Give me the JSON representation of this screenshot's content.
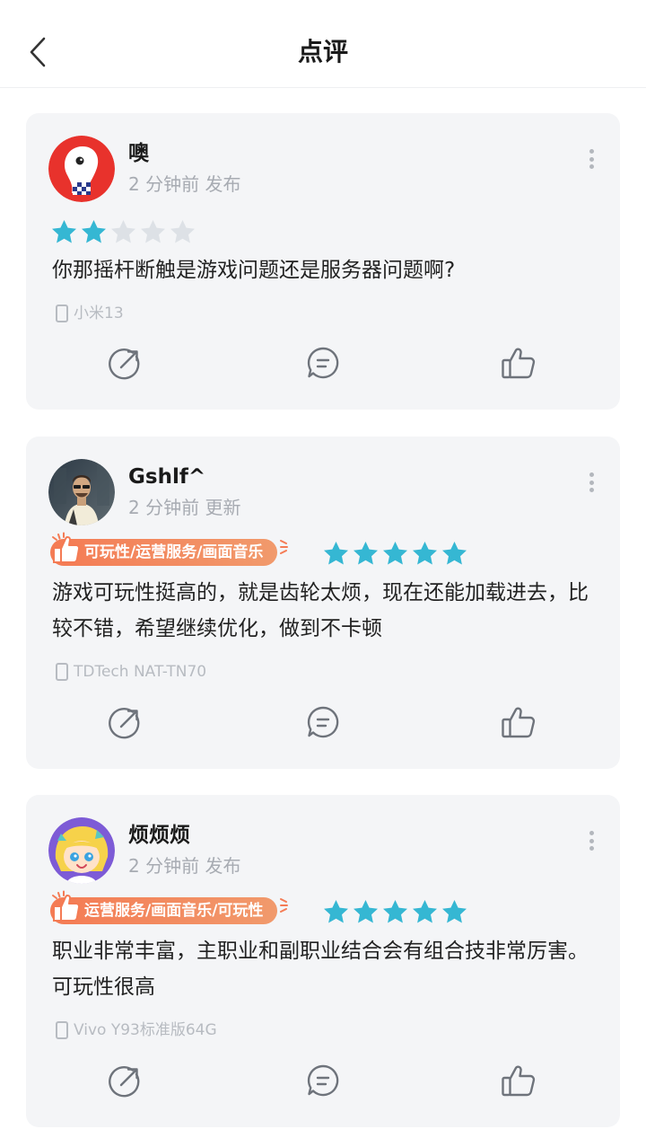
{
  "header": {
    "title": "点评"
  },
  "colors": {
    "star_on": "#35b7d3",
    "star_off": "#dde1e6",
    "tag_gradient": [
      "#f47b54",
      "#f19a6c"
    ],
    "card_bg": "#f4f5f7"
  },
  "reviews": [
    {
      "username": "噢",
      "time": "2 分钟前",
      "action": "发布",
      "rating": 2,
      "tag": "",
      "content": "你那摇杆断触是游戏问题还是服务器问题啊?",
      "device": "小米13",
      "avatar_icon": "white-bird-avatar"
    },
    {
      "username": "Gshlf^",
      "time": "2 分钟前",
      "action": "更新",
      "rating": 5,
      "tag": "可玩性/运营服务/画面音乐",
      "content": "游戏可玩性挺高的，就是齿轮太烦，现在还能加载进去，比较不错，希望继续优化，做到不卡顿",
      "device": "TDTech NAT-TN70",
      "avatar_icon": "man-photo-avatar"
    },
    {
      "username": "烦烦烦",
      "time": "2 分钟前",
      "action": "发布",
      "rating": 5,
      "tag": "运营服务/画面音乐/可玩性",
      "content": "职业非常丰富，主职业和副职业结合会有组合技非常厉害。可玩性很高",
      "device": "Vivo Y93标准版64G",
      "avatar_icon": "anime-girl-avatar"
    }
  ]
}
